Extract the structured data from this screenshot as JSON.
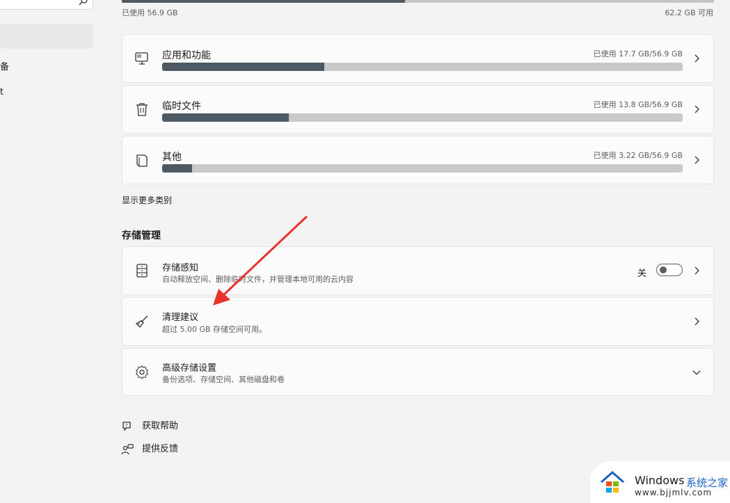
{
  "sidebar": {
    "items": [
      {
        "label": "备"
      },
      {
        "label": "t"
      }
    ]
  },
  "storage_summary": {
    "used_label": "已使用 56.9 GB",
    "free_label": "62.2 GB 可用",
    "used_fraction": 0.478
  },
  "categories": [
    {
      "title": "应用和功能",
      "usage": "已使用 17.7 GB/56.9 GB",
      "fraction": 0.311,
      "icon": "apps-monitor-icon"
    },
    {
      "title": "临时文件",
      "usage": "已使用 13.8 GB/56.9 GB",
      "fraction": 0.243,
      "icon": "trash-icon"
    },
    {
      "title": "其他",
      "usage": "已使用 3.22 GB/56.9 GB",
      "fraction": 0.057,
      "icon": "document-icon"
    }
  ],
  "show_more_label": "显示更多类别",
  "management": {
    "title": "存储管理",
    "storage_sense": {
      "title": "存储感知",
      "subtitle": "自动释放空间、删除临时文件，并管理本地可用的云内容",
      "toggle_label": "关",
      "toggle_on": false
    },
    "cleanup": {
      "title": "清理建议",
      "subtitle": "超过 5.00 GB 存储空间可用。"
    },
    "advanced": {
      "title": "高级存储设置",
      "subtitle": "备份选项、存储空间、其他磁盘和卷"
    }
  },
  "help": {
    "get_help": "获取帮助",
    "feedback": "提供反馈"
  },
  "watermark": {
    "brand": "Windows",
    "brand_cn": "系统之家",
    "url": "www.bjjmlv.com"
  },
  "colors": {
    "bar_fill": "#4d5a64",
    "bar_track": "#c9c9c9",
    "annotation_arrow": "#e8322b",
    "watermark_blue": "#1b62c7"
  }
}
